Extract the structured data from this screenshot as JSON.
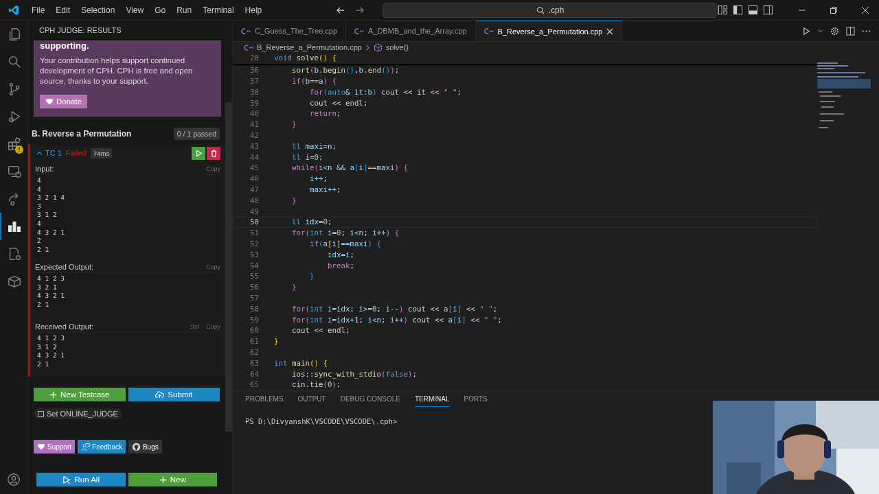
{
  "menu": [
    "File",
    "Edit",
    "Selection",
    "View",
    "Go",
    "Run",
    "Terminal",
    "Help"
  ],
  "command_center": {
    "value": ".cph"
  },
  "activity_bar": [
    {
      "kind": "files",
      "selected": false
    },
    {
      "kind": "search",
      "selected": false
    },
    {
      "kind": "source-control",
      "selected": false
    },
    {
      "kind": "debug",
      "selected": false
    },
    {
      "kind": "extensions",
      "selected": false,
      "warning": true
    },
    {
      "kind": "remote",
      "selected": false
    },
    {
      "kind": "share",
      "selected": false
    },
    {
      "kind": "judge",
      "selected": true
    },
    {
      "kind": "file-gear",
      "selected": false
    },
    {
      "kind": "box",
      "selected": false
    }
  ],
  "sidebar": {
    "title": "CPH JUDGE: RESULTS",
    "donate_card": {
      "heading": "supporting.",
      "text": "Your contribution helps support continued development of CPH. CPH is free and open source, thanks to your support.",
      "button": "Donate"
    },
    "problem": {
      "title": "B. Reverse a Permutation",
      "summary": "0 / 1 passed"
    },
    "testcase": {
      "label": "TC 1",
      "expanded": true,
      "passed": false,
      "status": "Failed",
      "time": "74ms",
      "sections": [
        {
          "label": "Input:",
          "actions": [
            "Copy"
          ],
          "text": "4\n4\n3 2 1 4\n3\n3 1 2\n4\n4 3 2 1\n2\n2 1"
        },
        {
          "label": "Expected Output:",
          "actions": [
            "Copy"
          ],
          "text": "4 1 2 3\n3 2 1\n4 3 2 1\n2 1"
        },
        {
          "label": "Received Output:",
          "actions": [
            "Set",
            "Copy"
          ],
          "text": "4 1 2 3\n3 1 2\n4 3 2 1\n2 1"
        }
      ]
    },
    "new_testcase": "New Testcase",
    "submit": "Submit",
    "online_judge": {
      "label": "Set ONLINE_JUDGE",
      "checked": false
    },
    "links": [
      {
        "kind": "support",
        "label": "Support"
      },
      {
        "kind": "feedback",
        "label": "Feedback"
      },
      {
        "kind": "bugs",
        "label": "Bugs"
      }
    ],
    "run_all": "Run All",
    "new": "New"
  },
  "tabs": [
    {
      "label": "C_Guess_The_Tree.cpp",
      "selected": false
    },
    {
      "label": "A_DBMB_and_the_Array.cpp",
      "selected": false
    },
    {
      "label": "B_Reverse_a_Permutation.cpp",
      "selected": true
    }
  ],
  "breadcrumb": [
    "B_Reverse_a_Permutation.cpp",
    "solve()"
  ],
  "sticky_line": {
    "number": "28",
    "tokens": [
      {
        "text": "void",
        "kind": "type"
      },
      {
        "text": " solve",
        "kind": "fn"
      },
      {
        "text": "() {",
        "kind": "b1"
      }
    ]
  },
  "code": [
    {
      "number": "36",
      "current": false,
      "tokens": [
        {
          "text": "    sort",
          "kind": "fn"
        },
        {
          "text": "(",
          "kind": "b2"
        },
        {
          "text": "b",
          "kind": "var"
        },
        {
          "text": "."
        },
        {
          "text": "begin",
          "kind": "fn"
        },
        {
          "text": "()",
          "kind": "b3"
        },
        {
          "text": ","
        },
        {
          "text": "b",
          "kind": "var"
        },
        {
          "text": "."
        },
        {
          "text": "end",
          "kind": "fn"
        },
        {
          "text": "()",
          "kind": "b3"
        },
        {
          "text": ")",
          "kind": "b2"
        },
        {
          "text": ";"
        }
      ]
    },
    {
      "number": "37",
      "current": false,
      "tokens": [
        {
          "text": "    if",
          "kind": "kw"
        },
        {
          "text": "(",
          "kind": "b2"
        },
        {
          "text": "b==a",
          "kind": "var"
        },
        {
          "text": ") {",
          "kind": "b2"
        }
      ]
    },
    {
      "number": "38",
      "current": false,
      "tokens": [
        {
          "text": "        for",
          "kind": "kw"
        },
        {
          "text": "(",
          "kind": "b3"
        },
        {
          "text": "auto",
          "kind": "type"
        },
        {
          "text": "& it:b",
          "kind": "var"
        },
        {
          "text": ")",
          "kind": "b3"
        },
        {
          "text": " cout << it << "
        },
        {
          "text": "\" \"",
          "kind": "str"
        },
        {
          "text": ";"
        }
      ]
    },
    {
      "number": "39",
      "current": false,
      "tokens": [
        {
          "text": "        cout << endl;"
        }
      ]
    },
    {
      "number": "40",
      "current": false,
      "tokens": [
        {
          "text": "        return",
          "kind": "kw"
        },
        {
          "text": ";"
        }
      ]
    },
    {
      "number": "41",
      "current": false,
      "tokens": [
        {
          "text": "    }",
          "kind": "b2"
        }
      ]
    },
    {
      "number": "42",
      "current": false
    },
    {
      "number": "43",
      "current": false,
      "tokens": [
        {
          "text": "    ll",
          "kind": "type"
        },
        {
          "text": " maxi",
          "kind": "var"
        },
        {
          "text": "="
        },
        {
          "text": "n",
          "kind": "var"
        },
        {
          "text": ";"
        }
      ]
    },
    {
      "number": "44",
      "current": false,
      "tokens": [
        {
          "text": "    ll",
          "kind": "type"
        },
        {
          "text": " i",
          "kind": "var"
        },
        {
          "text": "="
        },
        {
          "text": "0",
          "kind": "num"
        },
        {
          "text": ";"
        }
      ]
    },
    {
      "number": "45",
      "current": false,
      "tokens": [
        {
          "text": "    while",
          "kind": "kw"
        },
        {
          "text": "(",
          "kind": "b2"
        },
        {
          "text": "i<n && a",
          "kind": "var"
        },
        {
          "text": "[",
          "kind": "b3"
        },
        {
          "text": "i",
          "kind": "var"
        },
        {
          "text": "]",
          "kind": "b3"
        },
        {
          "text": "==maxi",
          "kind": "var"
        },
        {
          "text": ") {",
          "kind": "b2"
        }
      ]
    },
    {
      "number": "46",
      "current": false,
      "tokens": [
        {
          "text": "        i++",
          "kind": "var"
        },
        {
          "text": ";"
        }
      ]
    },
    {
      "number": "47",
      "current": false,
      "tokens": [
        {
          "text": "        maxi++",
          "kind": "var"
        },
        {
          "text": ";"
        }
      ]
    },
    {
      "number": "48",
      "current": false,
      "tokens": [
        {
          "text": "    }",
          "kind": "b2"
        }
      ]
    },
    {
      "number": "49",
      "current": false
    },
    {
      "number": "50",
      "current": true,
      "tokens": [
        {
          "text": "    ll",
          "kind": "type"
        },
        {
          "text": " idx",
          "kind": "var"
        },
        {
          "text": "="
        },
        {
          "text": "0",
          "kind": "num"
        },
        {
          "text": ";"
        }
      ]
    },
    {
      "number": "51",
      "current": false,
      "tokens": [
        {
          "text": "    for",
          "kind": "kw"
        },
        {
          "text": "(",
          "kind": "b2"
        },
        {
          "text": "int",
          "kind": "type"
        },
        {
          "text": " i",
          "kind": "var"
        },
        {
          "text": "="
        },
        {
          "text": "0",
          "kind": "num"
        },
        {
          "text": "; "
        },
        {
          "text": "i<n",
          "kind": "var"
        },
        {
          "text": "; "
        },
        {
          "text": "i++",
          "kind": "var"
        },
        {
          "text": ") {",
          "kind": "b2"
        }
      ]
    },
    {
      "number": "52",
      "current": false,
      "tokens": [
        {
          "text": "        if",
          "kind": "kw"
        },
        {
          "text": "(",
          "kind": "b3"
        },
        {
          "text": "a",
          "kind": "var"
        },
        {
          "text": "[",
          "kind": "b1"
        },
        {
          "text": "i",
          "kind": "var"
        },
        {
          "text": "]",
          "kind": "b1"
        },
        {
          "text": "==maxi",
          "kind": "var"
        },
        {
          "text": ") {",
          "kind": "b3"
        }
      ]
    },
    {
      "number": "53",
      "current": false,
      "tokens": [
        {
          "text": "            idx=i",
          "kind": "var"
        },
        {
          "text": ";"
        }
      ]
    },
    {
      "number": "54",
      "current": false,
      "tokens": [
        {
          "text": "            break",
          "kind": "kw"
        },
        {
          "text": ";"
        }
      ]
    },
    {
      "number": "55",
      "current": false,
      "tokens": [
        {
          "text": "        }",
          "kind": "b3"
        }
      ]
    },
    {
      "number": "56",
      "current": false,
      "tokens": [
        {
          "text": "    }",
          "kind": "b2"
        }
      ]
    },
    {
      "number": "57",
      "current": false
    },
    {
      "number": "58",
      "current": false,
      "tokens": [
        {
          "text": "    for",
          "kind": "kw"
        },
        {
          "text": "(",
          "kind": "b2"
        },
        {
          "text": "int",
          "kind": "type"
        },
        {
          "text": " i=idx; i>=0; i--",
          "kind": "var"
        },
        {
          "text": ")",
          "kind": "b2"
        },
        {
          "text": " cout << "
        },
        {
          "text": "a",
          "kind": "var"
        },
        {
          "text": "[",
          "kind": "b3"
        },
        {
          "text": "i",
          "kind": "var"
        },
        {
          "text": "]",
          "kind": "b3"
        },
        {
          "text": " << "
        },
        {
          "text": "\" \"",
          "kind": "str"
        },
        {
          "text": ";"
        }
      ]
    },
    {
      "number": "59",
      "current": false,
      "tokens": [
        {
          "text": "    for",
          "kind": "kw"
        },
        {
          "text": "(",
          "kind": "b2"
        },
        {
          "text": "int",
          "kind": "type"
        },
        {
          "text": " i=idx+1; i<n; i++",
          "kind": "var"
        },
        {
          "text": ")",
          "kind": "b2"
        },
        {
          "text": " cout << "
        },
        {
          "text": "a",
          "kind": "var"
        },
        {
          "text": "[",
          "kind": "b3"
        },
        {
          "text": "i",
          "kind": "var"
        },
        {
          "text": "]",
          "kind": "b3"
        },
        {
          "text": " << "
        },
        {
          "text": "\" \"",
          "kind": "str"
        },
        {
          "text": ";"
        }
      ]
    },
    {
      "number": "60",
      "current": false,
      "tokens": [
        {
          "text": "    cout << endl;"
        }
      ]
    },
    {
      "number": "61",
      "current": false,
      "tokens": [
        {
          "text": "}",
          "kind": "b1"
        }
      ]
    },
    {
      "number": "62",
      "current": false
    },
    {
      "number": "63",
      "current": false,
      "tokens": [
        {
          "text": "int",
          "kind": "type"
        },
        {
          "text": " main",
          "kind": "fn"
        },
        {
          "text": "() {",
          "kind": "b1"
        }
      ]
    },
    {
      "number": "64",
      "current": false,
      "tokens": [
        {
          "text": "    ios::"
        },
        {
          "text": "sync_with_stdio",
          "kind": "fn"
        },
        {
          "text": "(",
          "kind": "b2"
        },
        {
          "text": "false",
          "kind": "type"
        },
        {
          "text": ")",
          "kind": "b2"
        },
        {
          "text": ";"
        }
      ]
    },
    {
      "number": "65",
      "current": false,
      "tokens": [
        {
          "text": "    cin",
          "kind": "var"
        },
        {
          "text": "."
        },
        {
          "text": "tie",
          "kind": "fn"
        },
        {
          "text": "(",
          "kind": "b2"
        },
        {
          "text": "0",
          "kind": "num"
        },
        {
          "text": ")",
          "kind": "b2"
        },
        {
          "text": ";"
        }
      ]
    }
  ],
  "panel": {
    "tabs": [
      {
        "label": "PROBLEMS",
        "selected": false
      },
      {
        "label": "OUTPUT",
        "selected": false
      },
      {
        "label": "DEBUG CONSOLE",
        "selected": false
      },
      {
        "label": "TERMINAL",
        "selected": true
      },
      {
        "label": "PORTS",
        "selected": false
      }
    ],
    "terminal_lines": [
      "PS D:\\DivyanshK\\VSCODE\\VSCODE\\.cph>"
    ],
    "webcam": {
      "kind": "picture"
    }
  }
}
